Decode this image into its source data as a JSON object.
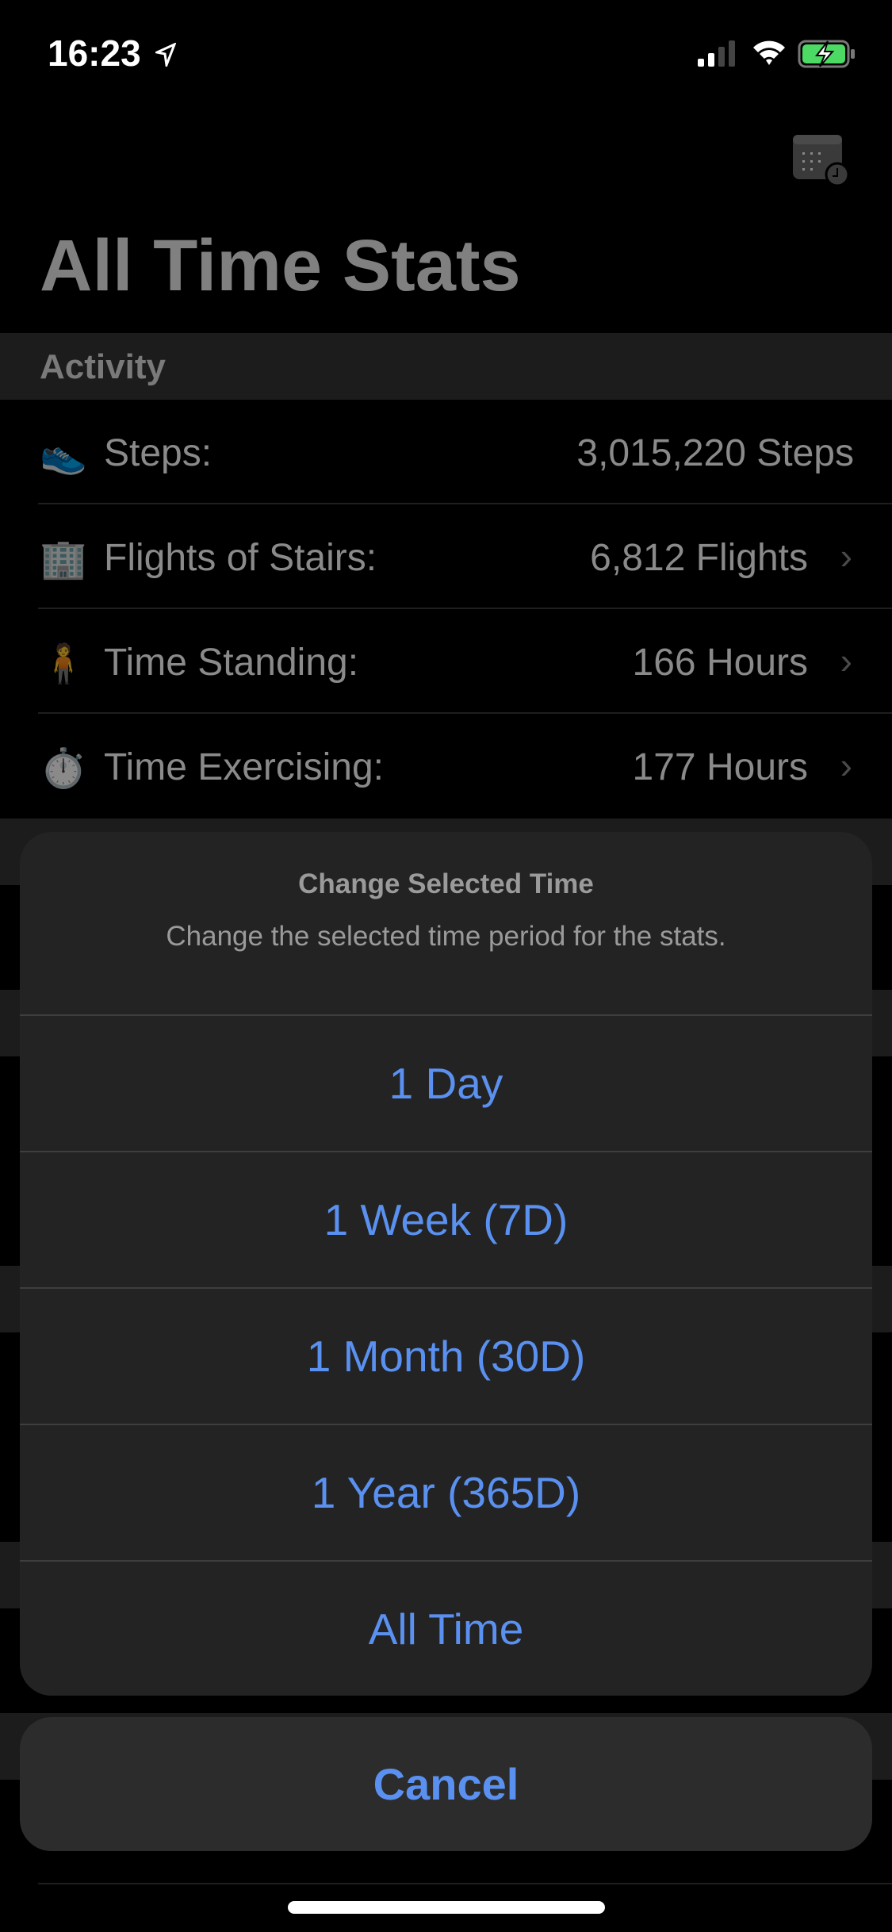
{
  "status_bar": {
    "time": "16:23"
  },
  "header": {
    "title": "All Time Stats"
  },
  "section": {
    "title": "Activity"
  },
  "rows": [
    {
      "emoji": "👟",
      "label": "Steps:",
      "value": "3,015,220 Steps",
      "chevron": false
    },
    {
      "emoji": "🏢",
      "label": "Flights of Stairs:",
      "value": "6,812 Flights",
      "chevron": true
    },
    {
      "emoji": "🧍",
      "label": "Time Standing:",
      "value": "166 Hours",
      "chevron": true
    },
    {
      "emoji": "⏱️",
      "label": "Time Exercising:",
      "value": "177 Hours",
      "chevron": true
    }
  ],
  "action_sheet": {
    "title": "Change Selected Time",
    "message": "Change the selected time period for the stats.",
    "options": [
      "1 Day",
      "1 Week (7D)",
      "1 Month (30D)",
      "1 Year (365D)",
      "All Time"
    ],
    "cancel": "Cancel"
  },
  "colors": {
    "accent": "#5a91f0",
    "battery": "#4cd964"
  }
}
